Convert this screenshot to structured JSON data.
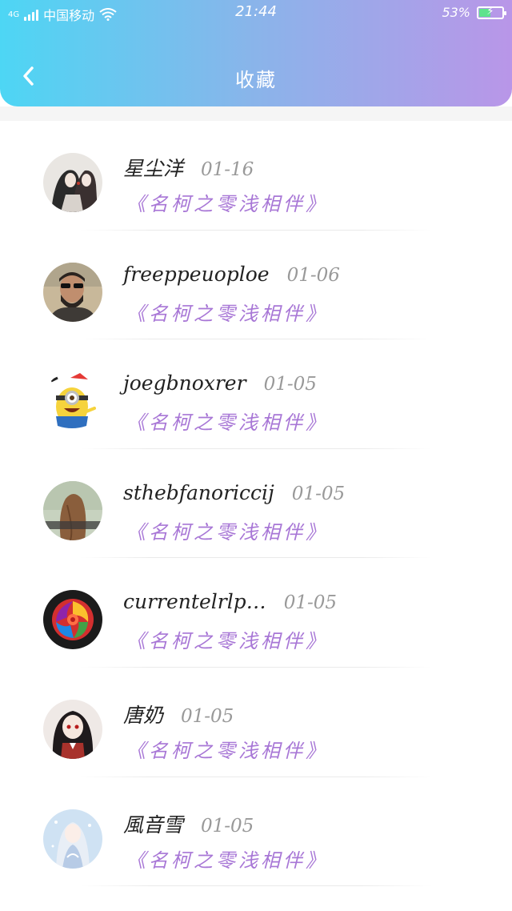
{
  "status_bar": {
    "network": "4G",
    "carrier": "中国移动",
    "time": "21:44",
    "battery": "53%",
    "battery_level": 0.53
  },
  "header": {
    "back_icon": "chevron-left-icon",
    "title": "收藏"
  },
  "favorites": [
    {
      "name": "星尘洋",
      "date": "01-16",
      "book": "《名柯之零浅相伴》",
      "avatar": "couple"
    },
    {
      "name": "freeppeuoploe",
      "date": "01-06",
      "book": "《名柯之零浅相伴》",
      "avatar": "bearded-man"
    },
    {
      "name": "joegbnoxrer",
      "date": "01-05",
      "book": "《名柯之零浅相伴》",
      "avatar": "minion"
    },
    {
      "name": "sthebfanoriccij",
      "date": "01-05",
      "book": "《名柯之零浅相伴》",
      "avatar": "girl-back"
    },
    {
      "name": "currentelrlp…",
      "date": "01-05",
      "book": "《名柯之零浅相伴》",
      "avatar": "rainbow-rose"
    },
    {
      "name": "唐奶",
      "date": "01-05",
      "book": "《名柯之零浅相伴》",
      "avatar": "anime-girl-dark"
    },
    {
      "name": "風音雪",
      "date": "01-05",
      "book": "《名柯之零浅相伴》",
      "avatar": "anime-girl-light"
    }
  ],
  "colors": {
    "header_gradient_start": "#4dd6f4",
    "header_gradient_end": "#b996e8",
    "book_title": "#a877d6",
    "date": "#999999"
  }
}
